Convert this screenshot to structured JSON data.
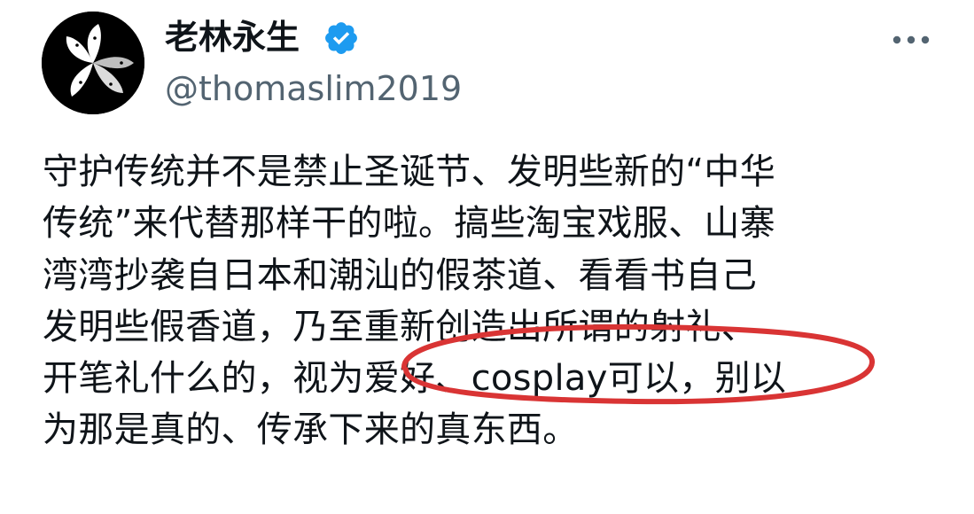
{
  "author": {
    "display_name": "老林永生",
    "handle": "@thomaslim2019",
    "avatar_icon": "bauhinia-flower-icon",
    "verified_icon": "verified-badge-icon",
    "verified_color": "#1d9bf0"
  },
  "more_icon": "more-options-icon",
  "tweet": {
    "lines": [
      "守护传统并不是禁止圣诞节、发明些新的“中华",
      "传统”来代替那样干的啦。搞些淘宝戏服、山寨",
      "湾湾抄袭自日本和潮汕的假茶道、看看书自己",
      "发明些假香道，乃至重新创造出所谓的射礼、",
      "开笔礼什么的，视为爱好、cosplay可以，别以",
      "为那是真的、传承下来的真东西。"
    ]
  },
  "annotation": {
    "type": "red-ellipse-highlight",
    "color": "#d93434"
  }
}
